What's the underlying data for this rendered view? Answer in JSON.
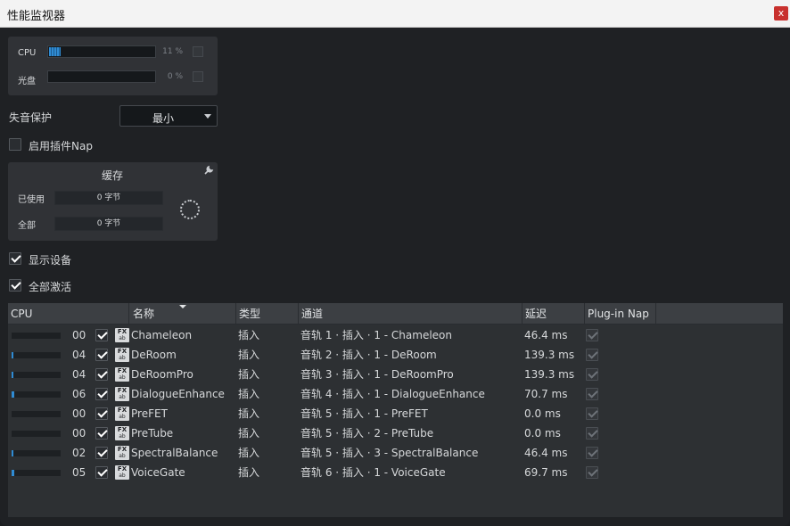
{
  "window": {
    "title": "性能监视器",
    "close_label": "x"
  },
  "meters": [
    {
      "label": "CPU",
      "percent": 11,
      "percent_label": "11 %"
    },
    {
      "label": "光盘",
      "percent": 0,
      "percent_label": "0 %"
    }
  ],
  "dropout": {
    "label": "失音保护",
    "value": "最小"
  },
  "plugin_nap": {
    "label": "启用插件Nap",
    "checked": false
  },
  "cache": {
    "title": "缓存",
    "used_label": "已使用",
    "used_value": "0 字节",
    "total_label": "全部",
    "total_value": "0 字节"
  },
  "show_devices": {
    "label": "显示设备",
    "checked": true
  },
  "all_active": {
    "label": "全部激活",
    "checked": true
  },
  "table": {
    "columns": {
      "cpu": "CPU",
      "name": "名称",
      "type": "类型",
      "channel": "通道",
      "latency": "延迟",
      "nap": "Plug-in Nap"
    },
    "rows": [
      {
        "cpu_pct": 0,
        "cpu": "00",
        "name": "Chameleon",
        "type": "插入",
        "channel": "音轨 1 · 插入 · 1 - Chameleon",
        "latency": "46.4 ms"
      },
      {
        "cpu_pct": 4,
        "cpu": "04",
        "name": "DeRoom",
        "type": "插入",
        "channel": "音轨 2 · 插入 · 1 - DeRoom",
        "latency": "139.3 ms"
      },
      {
        "cpu_pct": 4,
        "cpu": "04",
        "name": "DeRoomPro",
        "type": "插入",
        "channel": "音轨 3 · 插入 · 1 - DeRoomPro",
        "latency": "139.3 ms"
      },
      {
        "cpu_pct": 6,
        "cpu": "06",
        "name": "DialogueEnhance",
        "type": "插入",
        "channel": "音轨 4 · 插入 · 1 - DialogueEnhance",
        "latency": "70.7 ms"
      },
      {
        "cpu_pct": 0,
        "cpu": "00",
        "name": "PreFET",
        "type": "插入",
        "channel": "音轨 5 · 插入 · 1 - PreFET",
        "latency": "0.0 ms"
      },
      {
        "cpu_pct": 0,
        "cpu": "00",
        "name": "PreTube",
        "type": "插入",
        "channel": "音轨 5 · 插入 · 2 - PreTube",
        "latency": "0.0 ms"
      },
      {
        "cpu_pct": 2,
        "cpu": "02",
        "name": "SpectralBalance",
        "type": "插入",
        "channel": "音轨 5 · 插入 · 3 - SpectralBalance",
        "latency": "46.4 ms"
      },
      {
        "cpu_pct": 5,
        "cpu": "05",
        "name": "VoiceGate",
        "type": "插入",
        "channel": "音轨 6 · 插入 · 1 - VoiceGate",
        "latency": "69.7 ms"
      }
    ]
  },
  "fx_icon": {
    "top": "FX",
    "bottom": "ab"
  },
  "colors": {
    "accent": "#2f8bd3",
    "close": "#c8302d"
  }
}
